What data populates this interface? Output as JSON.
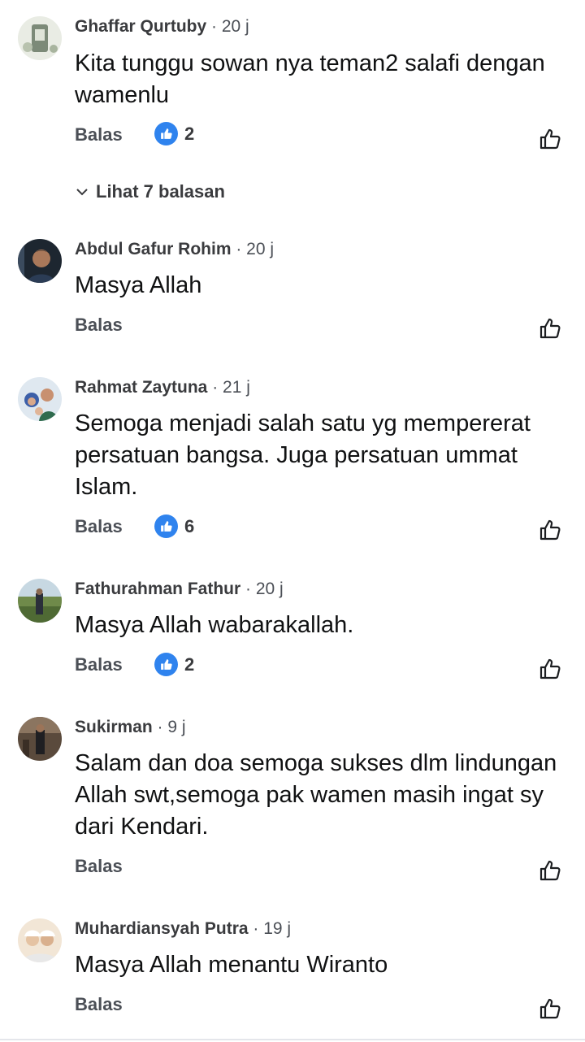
{
  "comments": [
    {
      "name": "Ghaffar Qurtuby",
      "sep": " · ",
      "time": "20 j",
      "text": "Kita tunggu sowan nya teman2 salafi dengan wamenlu",
      "reply_label": "Balas",
      "reactions": "2"
    },
    {
      "name": "Abdul Gafur Rohim",
      "sep": " · ",
      "time": "20 j",
      "text": "Masya Allah",
      "reply_label": "Balas",
      "reactions": ""
    },
    {
      "name": "Rahmat Zaytuna",
      "sep": " · ",
      "time": "21 j",
      "text": "Semoga menjadi salah satu yg mempererat persatuan bangsa. Juga persatuan ummat Islam.",
      "reply_label": "Balas",
      "reactions": "6"
    },
    {
      "name": "Fathurahman Fathur",
      "sep": " · ",
      "time": "20 j",
      "text": "Masya Allah wabarakallah.",
      "reply_label": "Balas",
      "reactions": "2"
    },
    {
      "name": "Sukirman",
      "sep": " · ",
      "time": "9 j",
      "text": "Salam dan doa semoga sukses dlm lindungan Allah swt,semoga pak wamen masih ingat sy dari Kendari.",
      "reply_label": "Balas",
      "reactions": ""
    },
    {
      "name": "Muhardiansyah Putra",
      "sep": " · ",
      "time": "19 j",
      "text": "Masya Allah menantu Wiranto",
      "reply_label": "Balas",
      "reactions": ""
    }
  ],
  "view_replies": {
    "label": "Lihat 7 balasan",
    "icon": "chevron-down-icon"
  },
  "icons": {
    "reaction": "like-reaction-icon",
    "like": "thumbs-up-outline-icon"
  },
  "colors": {
    "like_blue": "#2f83ee",
    "meta_gray": "#4b4f56",
    "text": "#101112"
  }
}
